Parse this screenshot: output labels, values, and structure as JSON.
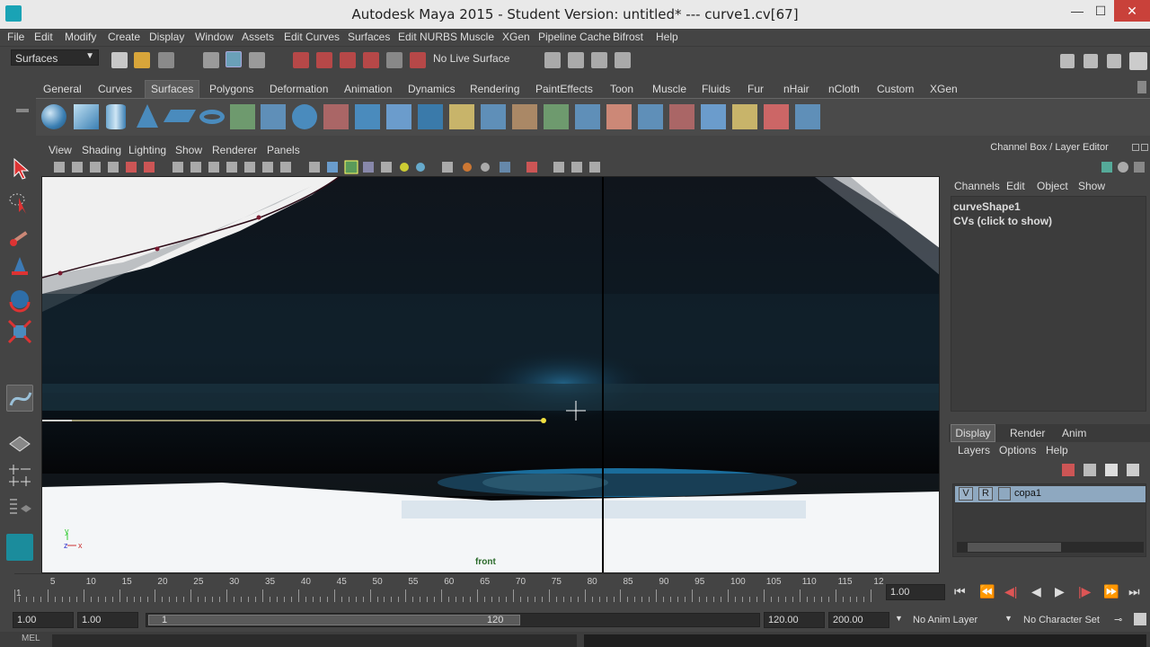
{
  "window": {
    "title": "Autodesk Maya 2015 - Student Version: untitled*   ---   curve1.cv[67]",
    "minimize": "—",
    "maximize": "☐",
    "close": "✕"
  },
  "menubar": [
    "File",
    "Edit",
    "Modify",
    "Create",
    "Display",
    "Window",
    "Assets",
    "Edit Curves",
    "Surfaces",
    "Edit NURBS",
    "Muscle",
    "XGen",
    "Pipeline Cache",
    "Bifrost",
    "Help"
  ],
  "statusline": {
    "menuset": "Surfaces",
    "live_surface": "No Live Surface"
  },
  "shelf": {
    "tabs": [
      "General",
      "Curves",
      "Surfaces",
      "Polygons",
      "Deformation",
      "Animation",
      "Dynamics",
      "Rendering",
      "PaintEffects",
      "Toon",
      "Muscle",
      "Fluids",
      "Fur",
      "nHair",
      "nCloth",
      "Custom",
      "XGen"
    ],
    "active_tab": "Surfaces"
  },
  "viewport": {
    "menus": [
      "View",
      "Shading",
      "Lighting",
      "Show",
      "Renderer",
      "Panels"
    ],
    "camera_label": "front",
    "axis_y": "y",
    "axis_z": "z",
    "axis_x": "x"
  },
  "channelbox": {
    "header": "Channel Box / Layer Editor",
    "menus": [
      "Channels",
      "Edit",
      "Object",
      "Show"
    ],
    "object_name": "curveShape1",
    "cv_hint": "CVs (click to show)"
  },
  "layereditor": {
    "tabs": [
      "Display",
      "Render",
      "Anim"
    ],
    "active_tab": "Display",
    "menus": [
      "Layers",
      "Options",
      "Help"
    ],
    "layer": {
      "v": "V",
      "r": "R",
      "name": "copa1"
    }
  },
  "timeline": {
    "ticks": [
      "5",
      "10",
      "15",
      "20",
      "25",
      "30",
      "35",
      "40",
      "45",
      "50",
      "55",
      "60",
      "65",
      "70",
      "75",
      "80",
      "85",
      "90",
      "95",
      "100",
      "105",
      "110",
      "115",
      "12"
    ],
    "start_marker": "1",
    "current_frame": "1.00"
  },
  "rangebar": {
    "start_time": "1.00",
    "playback_start": "1.00",
    "range_start_label": "1",
    "range_end_label": "120",
    "playback_end": "120.00",
    "end_time": "200.00",
    "anim_layer": "No Anim Layer",
    "character_set": "No Character Set"
  },
  "cmdline": {
    "label": "MEL"
  },
  "colors": {
    "accent": "#5285a6",
    "highlight_layer": "#8ea8c0",
    "curve": "#d6c27a"
  }
}
